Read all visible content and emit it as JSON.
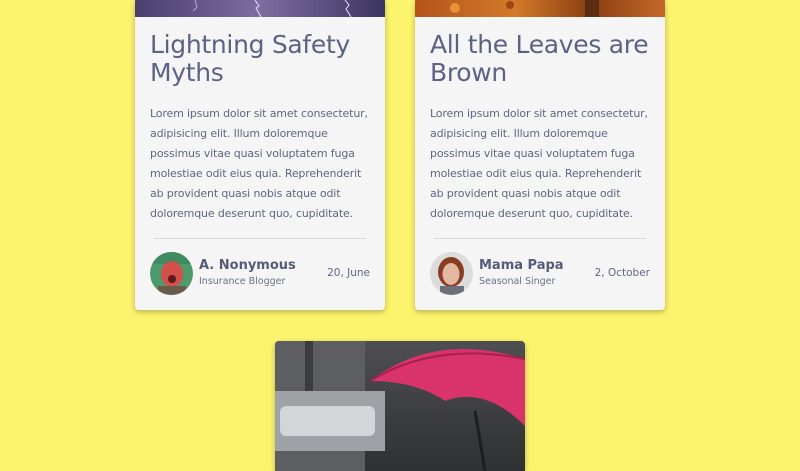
{
  "cards": [
    {
      "title": "Lightning Safety Myths",
      "text": "Lorem ipsum dolor sit amet consectetur, adipisicing elit. Illum doloremque possimus vitae quasi voluptatem fuga molestiae odit eius quia. Reprehenderit ab provident quasi nobis atque odit doloremque deserunt quo, cupiditate.",
      "image_icon": "lightning-storm-image",
      "author": {
        "name": "A. Nonymous",
        "role": "Insurance Blogger"
      },
      "date": "20, June"
    },
    {
      "title": "All the Leaves are Brown",
      "text": "Lorem ipsum dolor sit amet consectetur, adipisicing elit. Illum doloremque possimus vitae quasi voluptatem fuga molestiae odit eius quia. Reprehenderit ab provident quasi nobis atque odit doloremque deserunt quo, cupiditate.",
      "image_icon": "autumn-leaves-image",
      "author": {
        "name": "Mama Papa",
        "role": "Seasonal Singer"
      },
      "date": "2, October"
    },
    {
      "image_icon": "red-umbrella-image"
    }
  ],
  "colors": {
    "page_background": "#fdf46e",
    "card_background": "#f5f5f6",
    "text": "#5c6683"
  }
}
